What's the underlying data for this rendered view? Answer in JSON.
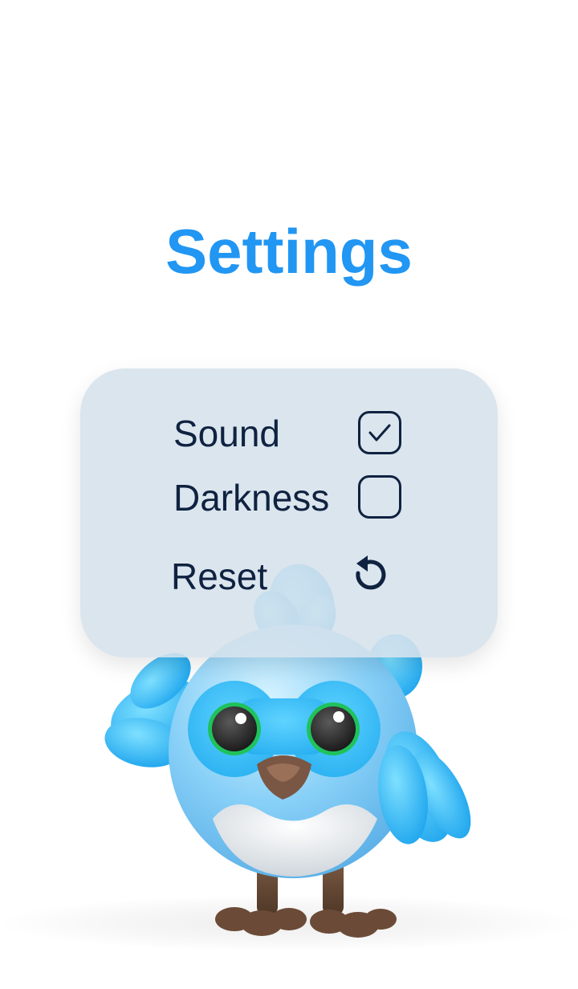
{
  "page": {
    "title": "Settings",
    "accent_color": "#2196f3",
    "text_color": "#0f2240",
    "panel_color": "#d6e1ec"
  },
  "settings": {
    "sound": {
      "label": "Sound",
      "checked": true,
      "icon": "check-icon"
    },
    "darkness": {
      "label": "Darkness",
      "checked": false
    },
    "reset": {
      "label": "Reset",
      "icon": "reset-icon"
    }
  },
  "mascot": {
    "description_icon": "blue-bird-mascot"
  }
}
